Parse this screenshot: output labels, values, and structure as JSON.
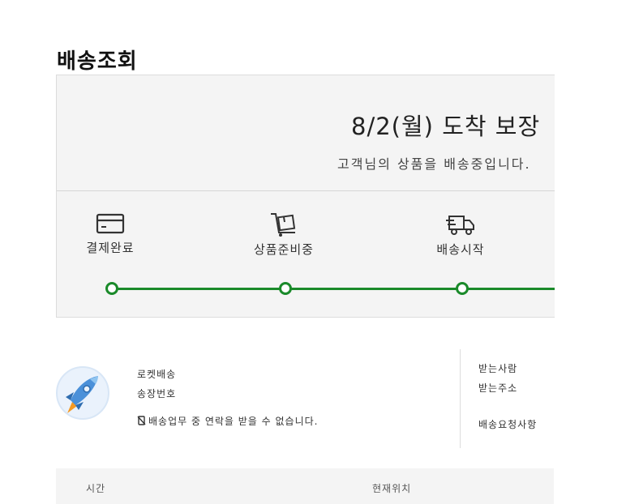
{
  "page": {
    "title": "배송조회"
  },
  "delivery": {
    "eta": "8/2(월) 도착 보장",
    "message": "고객님의 상품을 배송중입니다."
  },
  "steps": [
    {
      "label": "결제완료",
      "icon": "credit-card-icon"
    },
    {
      "label": "상품준비중",
      "icon": "box-cart-icon"
    },
    {
      "label": "배송시작",
      "icon": "truck-icon"
    }
  ],
  "colors": {
    "progress": "#1a8a2a",
    "panel": "#f4f4f4"
  },
  "shipping": {
    "carrier": "로켓배송",
    "tracking_label": "송장번호",
    "notice": "배송업무 중 연락을 받을 수 없습니다."
  },
  "recipient": {
    "name_label": "받는사람",
    "address_label": "받는주소",
    "request_label": "배송요청사항"
  },
  "table": {
    "columns": [
      "시간",
      "현재위치"
    ]
  }
}
